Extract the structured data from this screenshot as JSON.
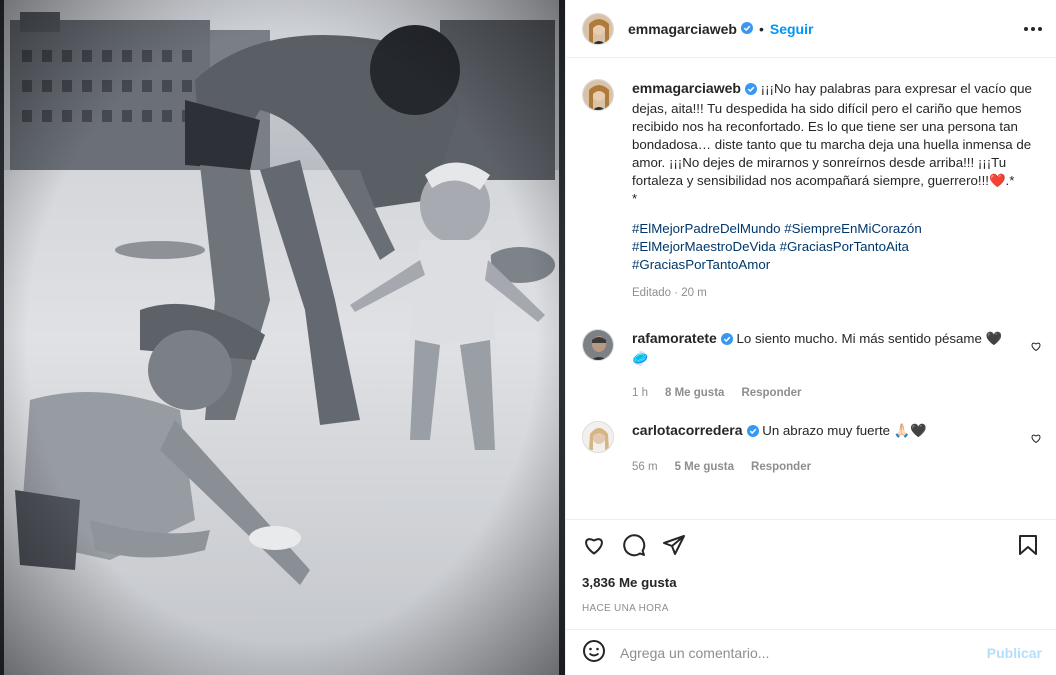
{
  "post": {
    "author": "emmagarciaweb",
    "follow_label": "Seguir",
    "separator": "•",
    "caption": "¡¡¡No hay palabras para expresar el vacío que dejas, aita!!! Tu despedida ha sido difícil pero el cariño que hemos recibido nos ha reconfortado. Es lo que tiene ser una persona tan bondadosa… diste tanto que tu marcha deja una huella inmensa de amor. ¡¡¡No dejes de mirarnos y sonreírnos desde arriba!!! ¡¡¡Tu fortaleza y sensibilidad nos acompañará siempre, guerrero!!!❤️.*",
    "caption_end": "*",
    "hashtags": [
      "#ElMejorPadreDelMundo #SiempreEnMiCorazón",
      "#ElMejorMaestroDeVida #GraciasPorTantoAita",
      "#GraciasPorTantoAmor"
    ],
    "edited": "Editado · 20 m"
  },
  "comments": [
    {
      "user": "rafamoratete",
      "text": "Lo siento mucho. Mi más sentido pésame 🖤",
      "extra": "🥏",
      "time": "1 h",
      "likes": "8 Me gusta",
      "reply": "Responder"
    },
    {
      "user": "carlotacorredera",
      "text": "Un abrazo muy fuerte 🙏🏻🖤",
      "time": "56 m",
      "likes": "5 Me gusta",
      "reply": "Responder"
    }
  ],
  "actions": {
    "likes": "3,836 Me gusta",
    "posted": "HACE UNA HORA"
  },
  "comment_box": {
    "placeholder": "Agrega un comentario...",
    "publish": "Publicar"
  },
  "icons": [
    "verified-icon",
    "more-icon",
    "heart-icon",
    "comment-icon",
    "share-icon",
    "bookmark-icon",
    "emoji-icon"
  ],
  "colors": {
    "link": "#0095f6",
    "hashtag": "#00376b",
    "muted": "#8e8e8e",
    "publish_disabled": "#b2dffc"
  }
}
